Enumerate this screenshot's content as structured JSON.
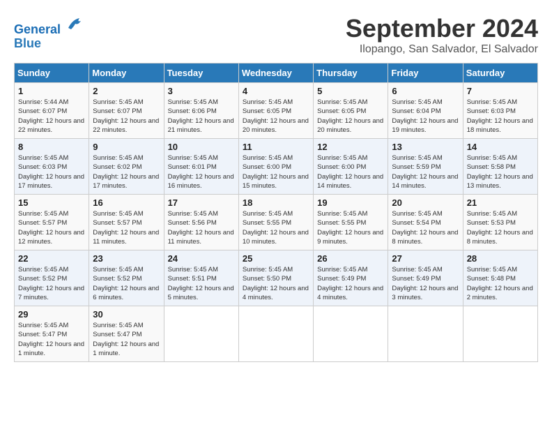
{
  "header": {
    "logo_line1": "General",
    "logo_line2": "Blue",
    "month": "September 2024",
    "location": "Ilopango, San Salvador, El Salvador"
  },
  "columns": [
    "Sunday",
    "Monday",
    "Tuesday",
    "Wednesday",
    "Thursday",
    "Friday",
    "Saturday"
  ],
  "weeks": [
    [
      {
        "day": "1",
        "text": "Sunrise: 5:44 AM\nSunset: 6:07 PM\nDaylight: 12 hours and 22 minutes."
      },
      {
        "day": "2",
        "text": "Sunrise: 5:45 AM\nSunset: 6:07 PM\nDaylight: 12 hours and 22 minutes."
      },
      {
        "day": "3",
        "text": "Sunrise: 5:45 AM\nSunset: 6:06 PM\nDaylight: 12 hours and 21 minutes."
      },
      {
        "day": "4",
        "text": "Sunrise: 5:45 AM\nSunset: 6:05 PM\nDaylight: 12 hours and 20 minutes."
      },
      {
        "day": "5",
        "text": "Sunrise: 5:45 AM\nSunset: 6:05 PM\nDaylight: 12 hours and 20 minutes."
      },
      {
        "day": "6",
        "text": "Sunrise: 5:45 AM\nSunset: 6:04 PM\nDaylight: 12 hours and 19 minutes."
      },
      {
        "day": "7",
        "text": "Sunrise: 5:45 AM\nSunset: 6:03 PM\nDaylight: 12 hours and 18 minutes."
      }
    ],
    [
      {
        "day": "8",
        "text": "Sunrise: 5:45 AM\nSunset: 6:03 PM\nDaylight: 12 hours and 17 minutes."
      },
      {
        "day": "9",
        "text": "Sunrise: 5:45 AM\nSunset: 6:02 PM\nDaylight: 12 hours and 17 minutes."
      },
      {
        "day": "10",
        "text": "Sunrise: 5:45 AM\nSunset: 6:01 PM\nDaylight: 12 hours and 16 minutes."
      },
      {
        "day": "11",
        "text": "Sunrise: 5:45 AM\nSunset: 6:00 PM\nDaylight: 12 hours and 15 minutes."
      },
      {
        "day": "12",
        "text": "Sunrise: 5:45 AM\nSunset: 6:00 PM\nDaylight: 12 hours and 14 minutes."
      },
      {
        "day": "13",
        "text": "Sunrise: 5:45 AM\nSunset: 5:59 PM\nDaylight: 12 hours and 14 minutes."
      },
      {
        "day": "14",
        "text": "Sunrise: 5:45 AM\nSunset: 5:58 PM\nDaylight: 12 hours and 13 minutes."
      }
    ],
    [
      {
        "day": "15",
        "text": "Sunrise: 5:45 AM\nSunset: 5:57 PM\nDaylight: 12 hours and 12 minutes."
      },
      {
        "day": "16",
        "text": "Sunrise: 5:45 AM\nSunset: 5:57 PM\nDaylight: 12 hours and 11 minutes."
      },
      {
        "day": "17",
        "text": "Sunrise: 5:45 AM\nSunset: 5:56 PM\nDaylight: 12 hours and 11 minutes."
      },
      {
        "day": "18",
        "text": "Sunrise: 5:45 AM\nSunset: 5:55 PM\nDaylight: 12 hours and 10 minutes."
      },
      {
        "day": "19",
        "text": "Sunrise: 5:45 AM\nSunset: 5:55 PM\nDaylight: 12 hours and 9 minutes."
      },
      {
        "day": "20",
        "text": "Sunrise: 5:45 AM\nSunset: 5:54 PM\nDaylight: 12 hours and 8 minutes."
      },
      {
        "day": "21",
        "text": "Sunrise: 5:45 AM\nSunset: 5:53 PM\nDaylight: 12 hours and 8 minutes."
      }
    ],
    [
      {
        "day": "22",
        "text": "Sunrise: 5:45 AM\nSunset: 5:52 PM\nDaylight: 12 hours and 7 minutes."
      },
      {
        "day": "23",
        "text": "Sunrise: 5:45 AM\nSunset: 5:52 PM\nDaylight: 12 hours and 6 minutes."
      },
      {
        "day": "24",
        "text": "Sunrise: 5:45 AM\nSunset: 5:51 PM\nDaylight: 12 hours and 5 minutes."
      },
      {
        "day": "25",
        "text": "Sunrise: 5:45 AM\nSunset: 5:50 PM\nDaylight: 12 hours and 4 minutes."
      },
      {
        "day": "26",
        "text": "Sunrise: 5:45 AM\nSunset: 5:49 PM\nDaylight: 12 hours and 4 minutes."
      },
      {
        "day": "27",
        "text": "Sunrise: 5:45 AM\nSunset: 5:49 PM\nDaylight: 12 hours and 3 minutes."
      },
      {
        "day": "28",
        "text": "Sunrise: 5:45 AM\nSunset: 5:48 PM\nDaylight: 12 hours and 2 minutes."
      }
    ],
    [
      {
        "day": "29",
        "text": "Sunrise: 5:45 AM\nSunset: 5:47 PM\nDaylight: 12 hours and 1 minute."
      },
      {
        "day": "30",
        "text": "Sunrise: 5:45 AM\nSunset: 5:47 PM\nDaylight: 12 hours and 1 minute."
      },
      {
        "day": "",
        "text": ""
      },
      {
        "day": "",
        "text": ""
      },
      {
        "day": "",
        "text": ""
      },
      {
        "day": "",
        "text": ""
      },
      {
        "day": "",
        "text": ""
      }
    ]
  ]
}
